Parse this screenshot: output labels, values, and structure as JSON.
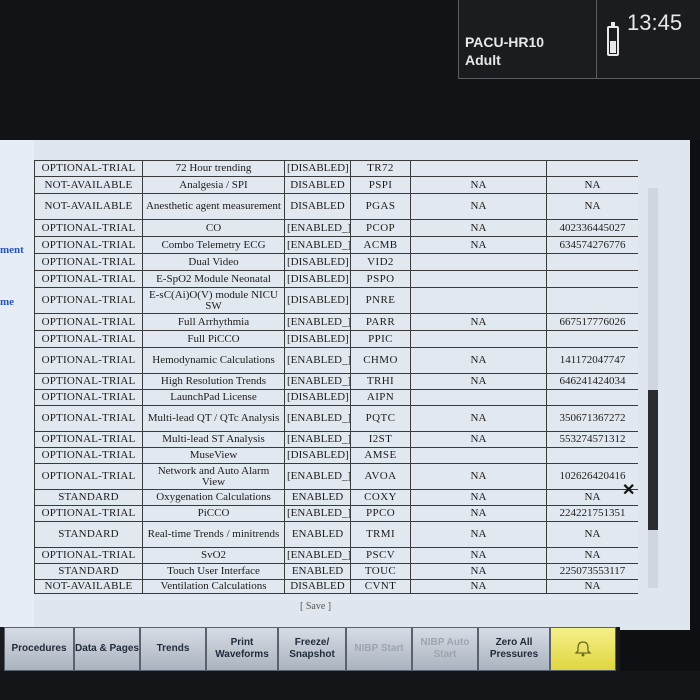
{
  "status": {
    "unit": "PACU-HR10",
    "patient_type": "Adult",
    "time": "13:45"
  },
  "left_links": [
    "ment",
    "me"
  ],
  "rows": [
    {
      "license": "OPTIONAL-TRIAL",
      "name": "72 Hour trending",
      "status": "[DISABLED]",
      "code": "TR72",
      "val1": "",
      "val2": ""
    },
    {
      "license": "NOT-AVAILABLE",
      "name": "Analgesia / SPI",
      "status": "DISABLED",
      "code": "PSPI",
      "val1": "NA",
      "val2": "NA"
    },
    {
      "license": "NOT-AVAILABLE",
      "name": "Anesthetic agent measurement",
      "status": "DISABLED",
      "code": "PGAS",
      "val1": "NA",
      "val2": "NA"
    },
    {
      "license": "OPTIONAL-TRIAL",
      "name": "CO",
      "status": "[ENABLED_]",
      "code": "PCOP",
      "val1": "NA",
      "val2": "402336445027"
    },
    {
      "license": "OPTIONAL-TRIAL",
      "name": "Combo Telemetry ECG",
      "status": "[ENABLED_]",
      "code": "ACMB",
      "val1": "NA",
      "val2": "634574276776"
    },
    {
      "license": "OPTIONAL-TRIAL",
      "name": "Dual Video",
      "status": "[DISABLED]",
      "code": "VID2",
      "val1": "",
      "val2": ""
    },
    {
      "license": "OPTIONAL-TRIAL",
      "name": "E-SpO2 Module Neonatal",
      "status": "[DISABLED]",
      "code": "PSPO",
      "val1": "",
      "val2": ""
    },
    {
      "license": "OPTIONAL-TRIAL",
      "name": "E-sC(Ai)O(V) module NICU SW",
      "status": "[DISABLED]",
      "code": "PNRE",
      "val1": "",
      "val2": ""
    },
    {
      "license": "OPTIONAL-TRIAL",
      "name": "Full Arrhythmia",
      "status": "[ENABLED_]",
      "code": "PARR",
      "val1": "NA",
      "val2": "667517776026"
    },
    {
      "license": "OPTIONAL-TRIAL",
      "name": "Full PiCCO",
      "status": "[DISABLED]",
      "code": "PPIC",
      "val1": "",
      "val2": ""
    },
    {
      "license": "OPTIONAL-TRIAL",
      "name": "Hemodynamic Calculations",
      "status": "[ENABLED_]",
      "code": "CHMO",
      "val1": "NA",
      "val2": "141172047747"
    },
    {
      "license": "OPTIONAL-TRIAL",
      "name": "High Resolution Trends",
      "status": "[ENABLED_]",
      "code": "TRHI",
      "val1": "NA",
      "val2": "646241424034"
    },
    {
      "license": "OPTIONAL-TRIAL",
      "name": "LaunchPad License",
      "status": "[DISABLED]",
      "code": "AIPN",
      "val1": "",
      "val2": ""
    },
    {
      "license": "OPTIONAL-TRIAL",
      "name": "Multi-lead QT / QTc Analysis",
      "status": "[ENABLED_]",
      "code": "PQTC",
      "val1": "NA",
      "val2": "350671367272"
    },
    {
      "license": "OPTIONAL-TRIAL",
      "name": "Multi-lead ST Analysis",
      "status": "[ENABLED_]",
      "code": "I2ST",
      "val1": "NA",
      "val2": "553274571312"
    },
    {
      "license": "OPTIONAL-TRIAL",
      "name": "MuseView",
      "status": "[DISABLED]",
      "code": "AMSE",
      "val1": "",
      "val2": ""
    },
    {
      "license": "OPTIONAL-TRIAL",
      "name": "Network and Auto Alarm View",
      "status": "[ENABLED_]",
      "code": "AVOA",
      "val1": "NA",
      "val2": "102626420416"
    },
    {
      "license": "STANDARD",
      "name": "Oxygenation Calculations",
      "status": "ENABLED",
      "code": "COXY",
      "val1": "NA",
      "val2": "NA"
    },
    {
      "license": "OPTIONAL-TRIAL",
      "name": "PiCCO",
      "status": "[ENABLED_]",
      "code": "PPCO",
      "val1": "NA",
      "val2": "224221751351"
    },
    {
      "license": "STANDARD",
      "name": "Real-time Trends / minitrends",
      "status": "ENABLED",
      "code": "TRMI",
      "val1": "NA",
      "val2": "NA"
    },
    {
      "license": "OPTIONAL-TRIAL",
      "name": "SvO2",
      "status": "[ENABLED_]",
      "code": "PSCV",
      "val1": "NA",
      "val2": "NA"
    },
    {
      "license": "STANDARD",
      "name": "Touch User Interface",
      "status": "ENABLED",
      "code": "TOUC",
      "val1": "NA",
      "val2": "225073553117"
    },
    {
      "license": "NOT-AVAILABLE",
      "name": "Ventilation Calculations",
      "status": "DISABLED",
      "code": "CVNT",
      "val1": "NA",
      "val2": "NA"
    }
  ],
  "save_label": "[ Save ]",
  "toolbar": {
    "procedures": "Procedures",
    "data_pages": "Data & Pages",
    "trends": "Trends",
    "print_waveforms": "Print Waveforms",
    "freeze_snapshot": "Freeze/ Snapshot",
    "nibp_start": "NIBP Start",
    "nibp_auto": "NIBP Auto Start",
    "zero_all": "Zero All Pressures",
    "alarm_icon": "alarm-bell-icon"
  }
}
